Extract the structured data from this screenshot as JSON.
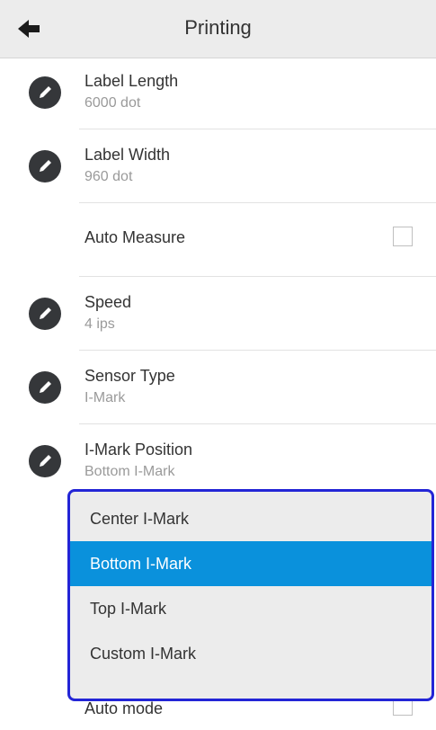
{
  "header": {
    "title": "Printing",
    "back_icon": "arrow-left-icon"
  },
  "settings": [
    {
      "label": "Label Length",
      "value": "6000 dot",
      "icon": "pencil-icon"
    },
    {
      "label": "Label Width",
      "value": "960 dot",
      "icon": "pencil-icon"
    },
    {
      "label": "Auto Measure",
      "checked": false
    },
    {
      "label": "Speed",
      "value": "4 ips",
      "icon": "pencil-icon"
    },
    {
      "label": "Sensor Type",
      "value": "I-Mark",
      "icon": "pencil-icon"
    },
    {
      "label": "I-Mark Position",
      "value": "Bottom I-Mark",
      "icon": "pencil-icon"
    }
  ],
  "dropdown": {
    "options": [
      "Center I-Mark",
      "Bottom I-Mark",
      "Top I-Mark",
      "Custom I-Mark"
    ],
    "selected": "Bottom I-Mark"
  },
  "partial": {
    "label": "Auto mode",
    "checked": false
  },
  "colors": {
    "header_bg": "#ececec",
    "icon_bg": "#35373a",
    "selected_bg": "#0a91dc",
    "dropdown_border": "#2325d6",
    "secondary_text": "#9a9a9a"
  }
}
